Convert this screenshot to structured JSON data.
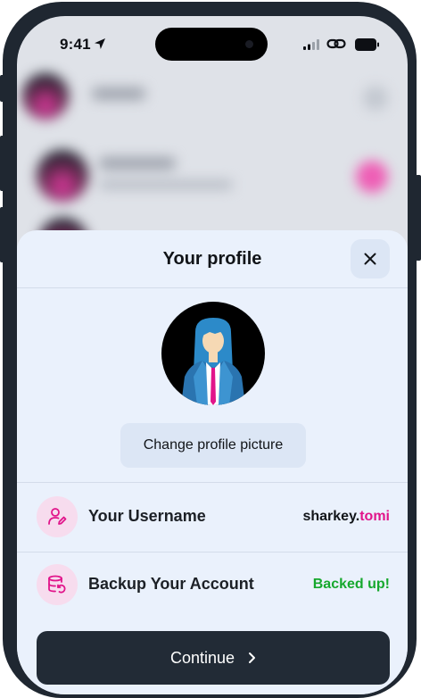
{
  "status_bar": {
    "time": "9:41"
  },
  "sheet": {
    "title": "Your profile",
    "change_picture_label": "Change profile picture",
    "rows": [
      {
        "label": "Your Username",
        "value_prefix": "sharkey.",
        "value_accent": "tomi",
        "icon": "user-edit-icon"
      },
      {
        "label": "Backup Your Account",
        "value": "Backed up!",
        "icon": "database-restore-icon"
      }
    ],
    "continue_label": "Continue"
  },
  "colors": {
    "accent": "#e1148a",
    "success": "#16a82d",
    "button_dark": "#222b36",
    "sheet_bg": "#eaf1fc"
  }
}
